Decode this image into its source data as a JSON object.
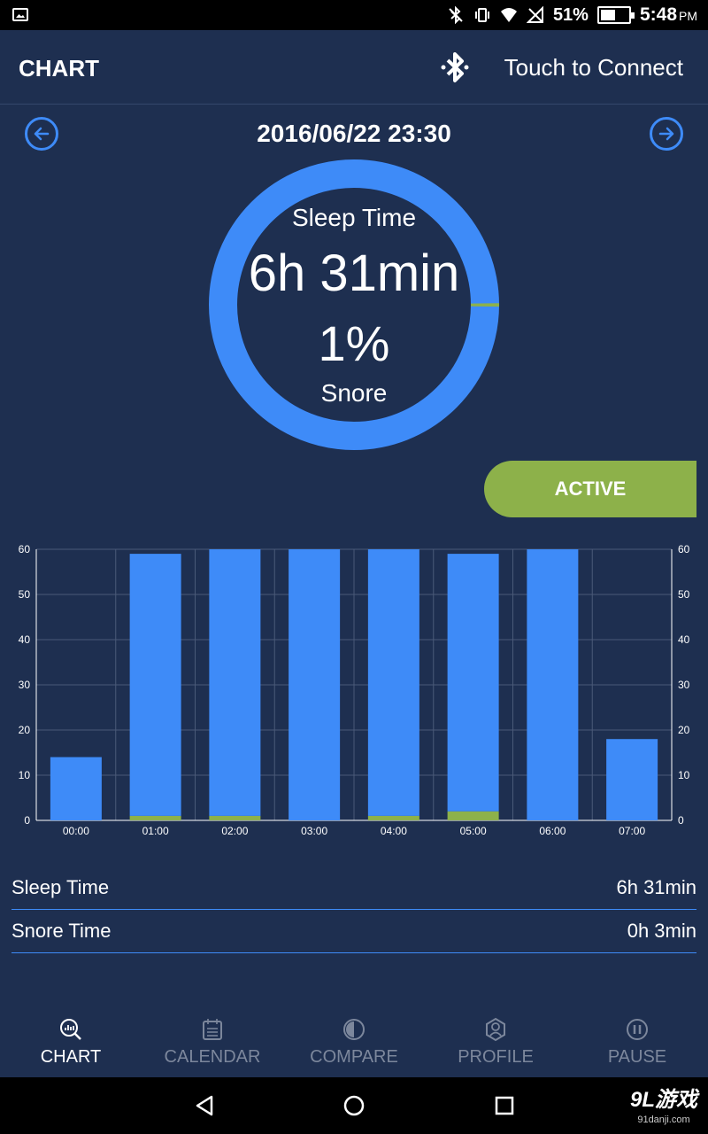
{
  "status_bar": {
    "battery": "51%",
    "time": "5:48",
    "ampm": "PM"
  },
  "header": {
    "title": "CHART",
    "connect_label": "Touch to Connect"
  },
  "date_nav": {
    "date": "2016/06/22 23:30"
  },
  "summary_ring": {
    "sleep_label": "Sleep Time",
    "sleep_value": "6h 31min",
    "snore_percent": "1%",
    "snore_label": "Snore",
    "snore_fraction": 0.01
  },
  "active_button": "ACTIVE",
  "chart_data": {
    "type": "bar",
    "stacked": true,
    "categories": [
      "00:00",
      "01:00",
      "02:00",
      "03:00",
      "04:00",
      "05:00",
      "06:00",
      "07:00"
    ],
    "series": [
      {
        "values": [
          14,
          58,
          59,
          60,
          59,
          57,
          60,
          18
        ]
      },
      {
        "values": [
          0,
          1,
          1,
          0,
          1,
          2,
          0,
          0
        ]
      }
    ],
    "ylim": [
      0,
      60
    ],
    "y_ticks": [
      0,
      10,
      20,
      30,
      40,
      50,
      60
    ],
    "grid": true,
    "colors": {
      "sleep": "#3e8bf8",
      "snore": "#8db14a"
    }
  },
  "summary": [
    {
      "label": "Sleep Time",
      "value": "6h 31min"
    },
    {
      "label": "Snore Time",
      "value": "0h 3min"
    }
  ],
  "tabs": [
    {
      "label": "CHART",
      "icon": "chart-search-icon",
      "active": true
    },
    {
      "label": "CALENDAR",
      "icon": "calendar-icon",
      "active": false
    },
    {
      "label": "COMPARE",
      "icon": "compare-icon",
      "active": false
    },
    {
      "label": "PROFILE",
      "icon": "profile-icon",
      "active": false
    },
    {
      "label": "PAUSE",
      "icon": "pause-icon",
      "active": false
    }
  ],
  "watermark": {
    "brand": "9L游戏",
    "site": "91danji.com"
  },
  "colors": {
    "background": "#1e2f50",
    "accent_blue": "#3e8bf8",
    "accent_green": "#8db14a"
  }
}
